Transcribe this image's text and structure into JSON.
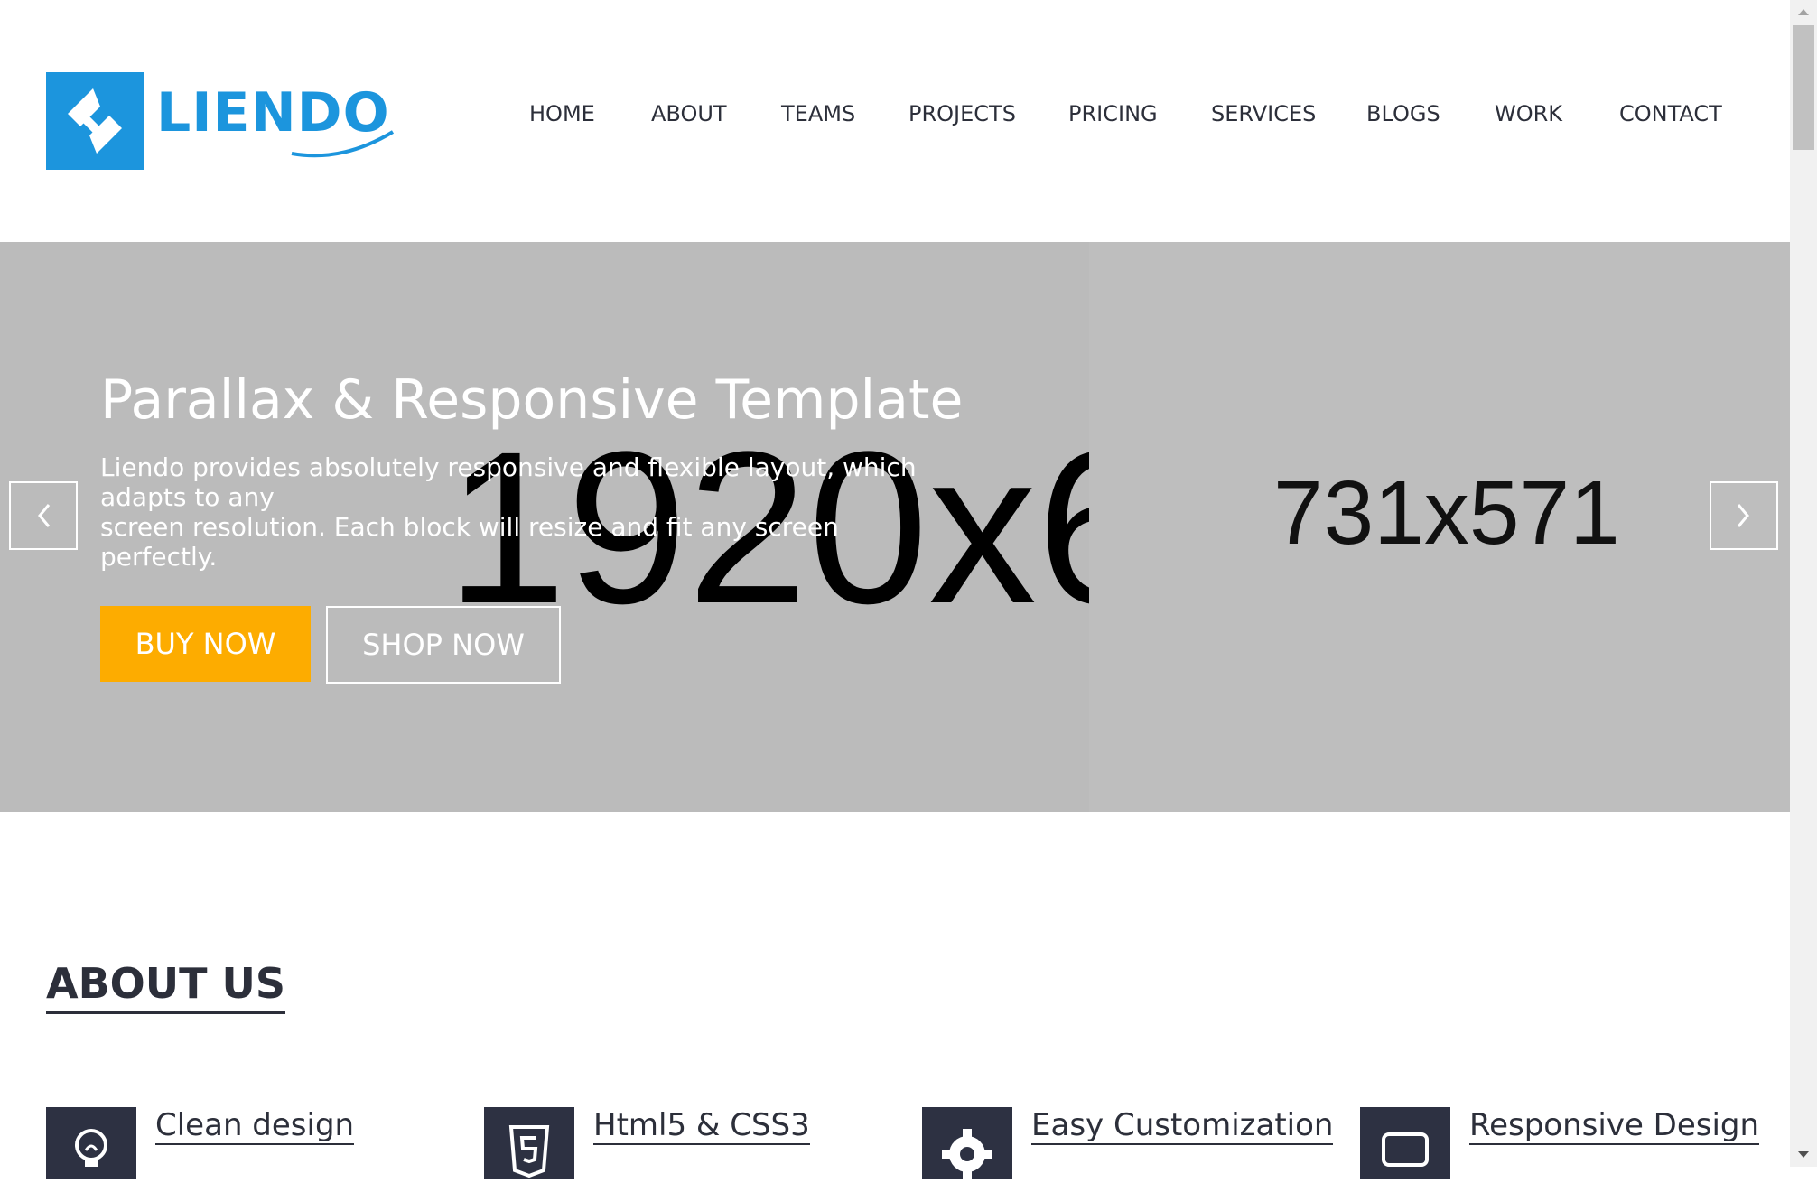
{
  "brand": {
    "name": "LIENDO",
    "color": "#1c95dd"
  },
  "nav": {
    "items": [
      "HOME",
      "ABOUT",
      "TEAMS",
      "PROJECTS",
      "PRICING",
      "SERVICES",
      "BLOGS",
      "WORK",
      "CONTACT"
    ]
  },
  "hero": {
    "title": "Parallax & Responsive Template",
    "description_line1": "Liendo provides absolutely responsive and flexible layout, which",
    "description_line2": "adapts to any",
    "description_line3": "screen resolution. Each block will resize and fit any screen perfectly.",
    "buy_label": "BUY NOW",
    "shop_label": "SHOP NOW",
    "placeholder_main": "1920x6",
    "placeholder_side": "731x571",
    "accent": "#fdac00",
    "background": "#bbbbbb"
  },
  "about": {
    "title": "ABOUT US",
    "features": [
      {
        "label": "Clean design",
        "icon": "lightbulb-icon"
      },
      {
        "label": "Html5 & CSS3",
        "icon": "html5-icon"
      },
      {
        "label": "Easy Customization",
        "icon": "gear-icon"
      },
      {
        "label": "Responsive Design",
        "icon": "laptop-icon"
      }
    ]
  }
}
